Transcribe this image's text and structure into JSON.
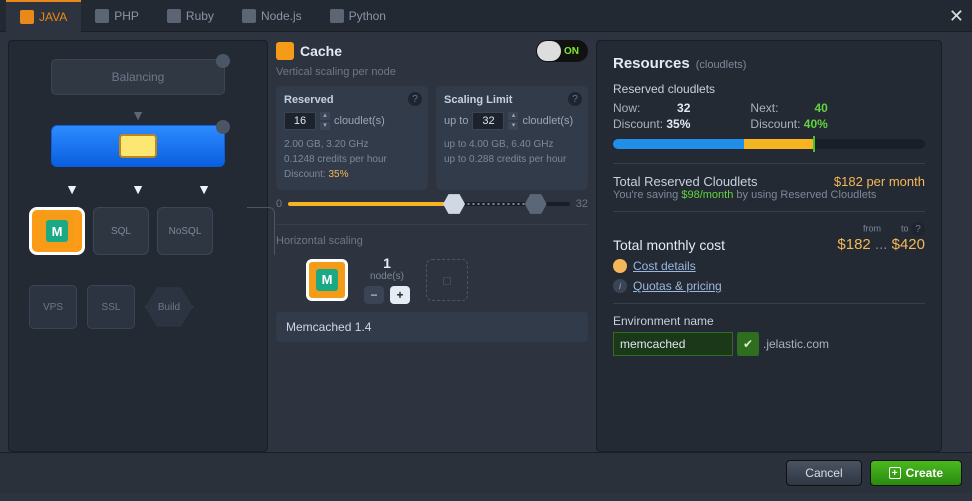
{
  "tabs": [
    "JAVA",
    "PHP",
    "Ruby",
    "Node.js",
    "Python"
  ],
  "activeTab": 0,
  "left": {
    "balancing": "Balancing",
    "tiles": [
      "SQL",
      "NoSQL"
    ],
    "bottom": [
      "VPS",
      "SSL",
      "Build"
    ]
  },
  "cache": {
    "title": "Cache",
    "toggle": "ON",
    "sub": "Vertical scaling per node",
    "reserved": {
      "label": "Reserved",
      "value": "16",
      "unit": "cloudlet(s)",
      "l1": "2.00 GB, 3.20 GHz",
      "l2": "0.1248 credits per hour",
      "disc_lbl": "Discount:",
      "disc": "35%"
    },
    "limit": {
      "label": "Scaling Limit",
      "pre": "up to",
      "value": "32",
      "unit": "cloudlet(s)",
      "l1": "up to 4.00 GB, 6.40 GHz",
      "l2": "up to 0.288 credits per hour"
    },
    "slider": {
      "min": "0",
      "max": "32"
    },
    "hscale": {
      "label": "Horizontal scaling",
      "count": "1",
      "unit": "node(s)",
      "name": "Memcached 1.4"
    }
  },
  "res": {
    "title": "Resources",
    "sub": "(cloudlets)",
    "reserved": "Reserved cloudlets",
    "now_l": "Now:",
    "now_v": "32",
    "next_l": "Next:",
    "next_v": "40",
    "disc_l": "Discount:",
    "disc_now": "35%",
    "disc_next": "40%",
    "trc_l": "Total Reserved Cloudlets",
    "trc_v": "$182 per month",
    "save_pre": "You're saving ",
    "save_v": "$98/month",
    "save_post": " by using Reserved Cloudlets",
    "tmc_l": "Total monthly cost",
    "from": "from",
    "to": "to",
    "low": "$182",
    "sep": "...",
    "high": "$420",
    "cost": "Cost details",
    "quotas": "Quotas & pricing",
    "env_l": "Environment name",
    "env_v": "memcached",
    "domain": ".jelastic.com"
  },
  "footer": {
    "cancel": "Cancel",
    "create": "Create"
  }
}
